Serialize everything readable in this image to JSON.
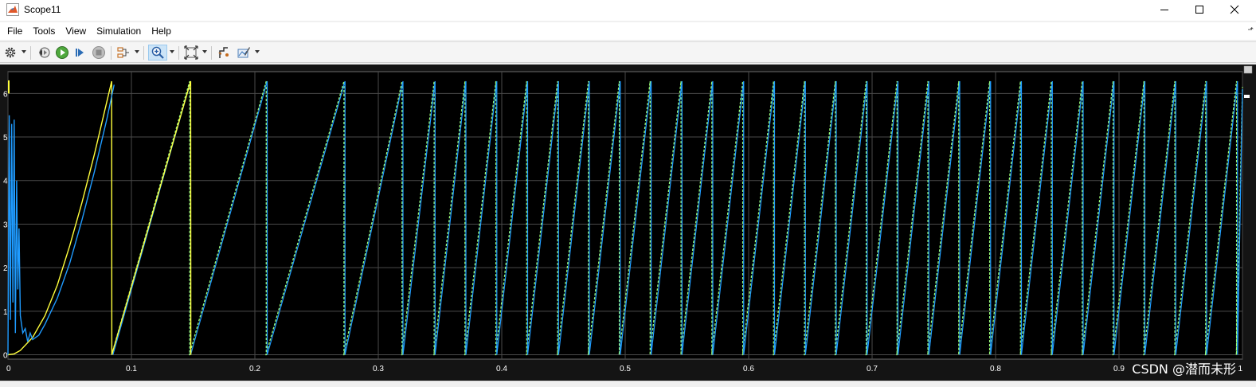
{
  "window": {
    "title": "Scope11"
  },
  "menu": {
    "items": [
      "File",
      "Tools",
      "View",
      "Simulation",
      "Help"
    ]
  },
  "toolbar": {
    "icons": [
      "gear-icon",
      "step-back-icon",
      "run-icon",
      "step-forward-icon",
      "stop-icon",
      "signal-select-icon",
      "zoom-in-icon",
      "fit-axes-icon",
      "triggers-icon",
      "measurements-icon"
    ],
    "zoom_active": true
  },
  "watermark": "CSDN @潜而未形",
  "colors": {
    "plot_background": "#000000",
    "panel_background": "#141414",
    "grid": "#4a4a4a",
    "tick_text": "#ffffff",
    "series_yellow": "#ffff3c",
    "series_blue": "#1f9bff",
    "series_green": "#9cff7a"
  },
  "chart_data": {
    "type": "line",
    "title": "",
    "xlabel": "",
    "ylabel": "",
    "xlim": [
      0,
      1
    ],
    "ylim": [
      -0.1,
      6.5
    ],
    "grid": true,
    "legend": "none",
    "x_ticks": [
      "0",
      "0.1",
      "0.2",
      "0.3",
      "0.4",
      "0.5",
      "0.6",
      "0.7",
      "0.8",
      "0.9",
      "1"
    ],
    "x_tick_values": [
      0,
      0.1,
      0.2,
      0.3,
      0.4,
      0.5,
      0.6,
      0.7,
      0.8,
      0.9,
      1
    ],
    "y_ticks": [
      "0",
      "1",
      "2",
      "3",
      "4",
      "5",
      "6"
    ],
    "y_tick_values": [
      0,
      1,
      2,
      3,
      4,
      5,
      6
    ],
    "sawtooth_peak": 6.28,
    "series": [
      {
        "color": "#ffff3c",
        "kind": "yellow-reference",
        "x": [
          0,
          0.005,
          0.01,
          0.02,
          0.03,
          0.04,
          0.05,
          0.06,
          0.07,
          0.08,
          0.084,
          0.0841,
          0.148,
          0.1481,
          0.3
        ],
        "y": [
          0,
          0.02,
          0.1,
          0.4,
          0.9,
          1.6,
          2.5,
          3.5,
          4.6,
          5.8,
          6.28,
          0,
          6.28,
          0,
          2.5
        ]
      },
      {
        "color": "#1f9bff",
        "kind": "blue-estimate",
        "early_x": [
          0.0,
          0.001,
          0.002,
          0.003,
          0.004,
          0.005,
          0.006,
          0.007,
          0.008,
          0.009,
          0.01,
          0.012,
          0.014,
          0.016,
          0.018,
          0.02,
          0.025,
          0.03,
          0.04,
          0.05,
          0.06,
          0.07,
          0.08,
          0.086
        ],
        "early_y": [
          0,
          5.5,
          0.8,
          5.3,
          1.2,
          5.4,
          0.5,
          4.0,
          1.5,
          2.9,
          0.9,
          0.5,
          0.6,
          0.3,
          0.5,
          0.35,
          0.45,
          0.7,
          1.3,
          2.1,
          3.1,
          4.2,
          5.4,
          6.2
        ]
      }
    ],
    "wrap_times": [
      0.085,
      0.148,
      0.21,
      0.273,
      0.32,
      0.346,
      0.371,
      0.396,
      0.421,
      0.446,
      0.471,
      0.496,
      0.521,
      0.546,
      0.571,
      0.596,
      0.621,
      0.646,
      0.671,
      0.696,
      0.721,
      0.746,
      0.771,
      0.796,
      0.821,
      0.846,
      0.871,
      0.896,
      0.921,
      0.946,
      0.971,
      0.996
    ]
  }
}
